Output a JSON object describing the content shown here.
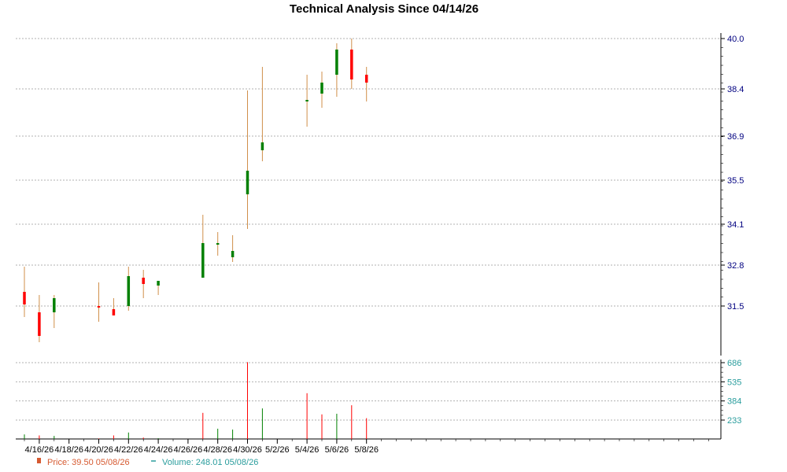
{
  "chart_data": {
    "type": "candlestick",
    "title": "Technical Analysis Since 04/14/26",
    "x_tick_labels": [
      "4/16/26",
      "4/18/26",
      "4/20/26",
      "4/22/26",
      "4/24/26",
      "4/26/26",
      "4/28/26",
      "4/30/26",
      "5/2/26",
      "5/4/26",
      "5/6/26",
      "5/8/26"
    ],
    "price_ticks": [
      "40.0",
      "38.4",
      "36.9",
      "35.5",
      "34.1",
      "32.8",
      "31.5"
    ],
    "price_range": [
      29.7,
      40.02
    ],
    "volume_ticks": [
      "686",
      "535",
      "384",
      "233"
    ],
    "volume_range": [
      85,
      686
    ],
    "grid": true,
    "colors": {
      "up": "#008000",
      "down": "#ff0000",
      "wick": "#d08f4a",
      "price_axis": "#000080",
      "volume_axis": "#2a9d9d",
      "grid": "#b0b0b0"
    },
    "candles": [
      {
        "date": "4/15/26",
        "open": 31.95,
        "high": 32.75,
        "low": 31.15,
        "close": 31.55
      },
      {
        "date": "4/16/26",
        "open": 31.3,
        "high": 31.85,
        "low": 30.35,
        "close": 30.55
      },
      {
        "date": "4/17/26",
        "open": 31.3,
        "high": 31.85,
        "low": 30.8,
        "close": 31.75
      },
      {
        "date": "4/20/26",
        "open": 31.5,
        "high": 32.25,
        "low": 31.0,
        "close": 31.45
      },
      {
        "date": "4/21/26",
        "open": 31.4,
        "high": 31.75,
        "low": 31.2,
        "close": 31.2
      },
      {
        "date": "4/22/26",
        "open": 31.5,
        "high": 32.75,
        "low": 31.35,
        "close": 32.45
      },
      {
        "date": "4/23/26",
        "open": 32.4,
        "high": 32.65,
        "low": 31.75,
        "close": 32.2
      },
      {
        "date": "4/24/26",
        "open": 32.15,
        "high": 32.3,
        "low": 31.85,
        "close": 32.3
      },
      {
        "date": "4/27/26",
        "open": 32.4,
        "high": 34.4,
        "low": 32.4,
        "close": 33.5
      },
      {
        "date": "4/28/26",
        "open": 33.45,
        "high": 33.85,
        "low": 33.1,
        "close": 33.5
      },
      {
        "date": "4/29/26",
        "open": 33.05,
        "high": 33.75,
        "low": 32.9,
        "close": 33.25
      },
      {
        "date": "4/30/26",
        "open": 35.05,
        "high": 38.35,
        "low": 33.95,
        "close": 35.8
      },
      {
        "date": "5/1/26",
        "open": 36.45,
        "high": 39.1,
        "low": 36.1,
        "close": 36.7
      },
      {
        "date": "5/4/26",
        "open": 38.05,
        "high": 38.85,
        "low": 37.2,
        "close": 38.05
      },
      {
        "date": "5/5/26",
        "open": 38.25,
        "high": 38.95,
        "low": 37.8,
        "close": 38.6
      },
      {
        "date": "5/6/26",
        "open": 38.85,
        "high": 39.85,
        "low": 38.15,
        "close": 39.65
      },
      {
        "date": "5/7/26",
        "open": 39.65,
        "high": 40.0,
        "low": 38.4,
        "close": 38.7
      },
      {
        "date": "5/8/26",
        "open": 38.85,
        "high": 39.1,
        "low": 38.0,
        "close": 38.6
      }
    ],
    "volume_bars": [
      {
        "date": "4/15/26",
        "value": 120,
        "direction": "up"
      },
      {
        "date": "4/16/26",
        "value": 112,
        "direction": "down"
      },
      {
        "date": "4/17/26",
        "value": 108,
        "direction": "up"
      },
      {
        "date": "4/20/26",
        "value": 88,
        "direction": "down"
      },
      {
        "date": "4/21/26",
        "value": 112,
        "direction": "down"
      },
      {
        "date": "4/22/26",
        "value": 135,
        "direction": "up"
      },
      {
        "date": "4/23/26",
        "value": 95,
        "direction": "down"
      },
      {
        "date": "4/24/26",
        "value": 90,
        "direction": "up"
      },
      {
        "date": "4/27/26",
        "value": 290,
        "direction": "down"
      },
      {
        "date": "4/28/26",
        "value": 165,
        "direction": "up"
      },
      {
        "date": "4/29/26",
        "value": 158,
        "direction": "up"
      },
      {
        "date": "4/30/26",
        "value": 690,
        "direction": "down"
      },
      {
        "date": "5/1/26",
        "value": 325,
        "direction": "up"
      },
      {
        "date": "5/4/26",
        "value": 445,
        "direction": "down"
      },
      {
        "date": "5/5/26",
        "value": 278,
        "direction": "down"
      },
      {
        "date": "5/6/26",
        "value": 283,
        "direction": "up"
      },
      {
        "date": "5/7/26",
        "value": 350,
        "direction": "down"
      },
      {
        "date": "5/8/26",
        "value": 248,
        "direction": "down"
      }
    ],
    "legend": {
      "price_label": "Price: 39.50  05/08/26",
      "volume_label": "Volume: 248.01  05/08/26"
    }
  }
}
